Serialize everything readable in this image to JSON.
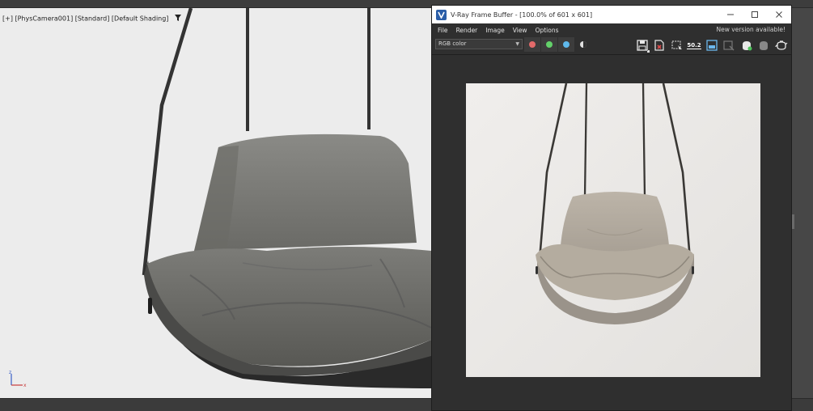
{
  "viewport": {
    "label": "[+] [PhysCamera001] [Standard] [Default Shading]",
    "icon": "filter-icon",
    "background": "#ececec"
  },
  "vfb": {
    "title": "V-Ray Frame Buffer - [100.0% of 601 x 601]",
    "menu": [
      "File",
      "Render",
      "Image",
      "View",
      "Options"
    ],
    "new_version": "New version available!",
    "channel": "RGB color",
    "channel_buttons": [
      {
        "name": "red-channel-button",
        "color": "#e36a6a"
      },
      {
        "name": "green-channel-button",
        "color": "#63d16a"
      },
      {
        "name": "blue-channel-button",
        "color": "#5fb9ec"
      }
    ],
    "toolbar_icons": [
      "save-icon",
      "clear-image-icon",
      "region-render-icon",
      "exposure-icon",
      "compare-icon",
      "interactive-render-icon",
      "render-icon",
      "stop-render-icon",
      "teapot-render-icon"
    ],
    "exposure_label": "50.2",
    "window_controls": [
      "minimize-icon",
      "maximize-icon",
      "close-icon"
    ]
  }
}
